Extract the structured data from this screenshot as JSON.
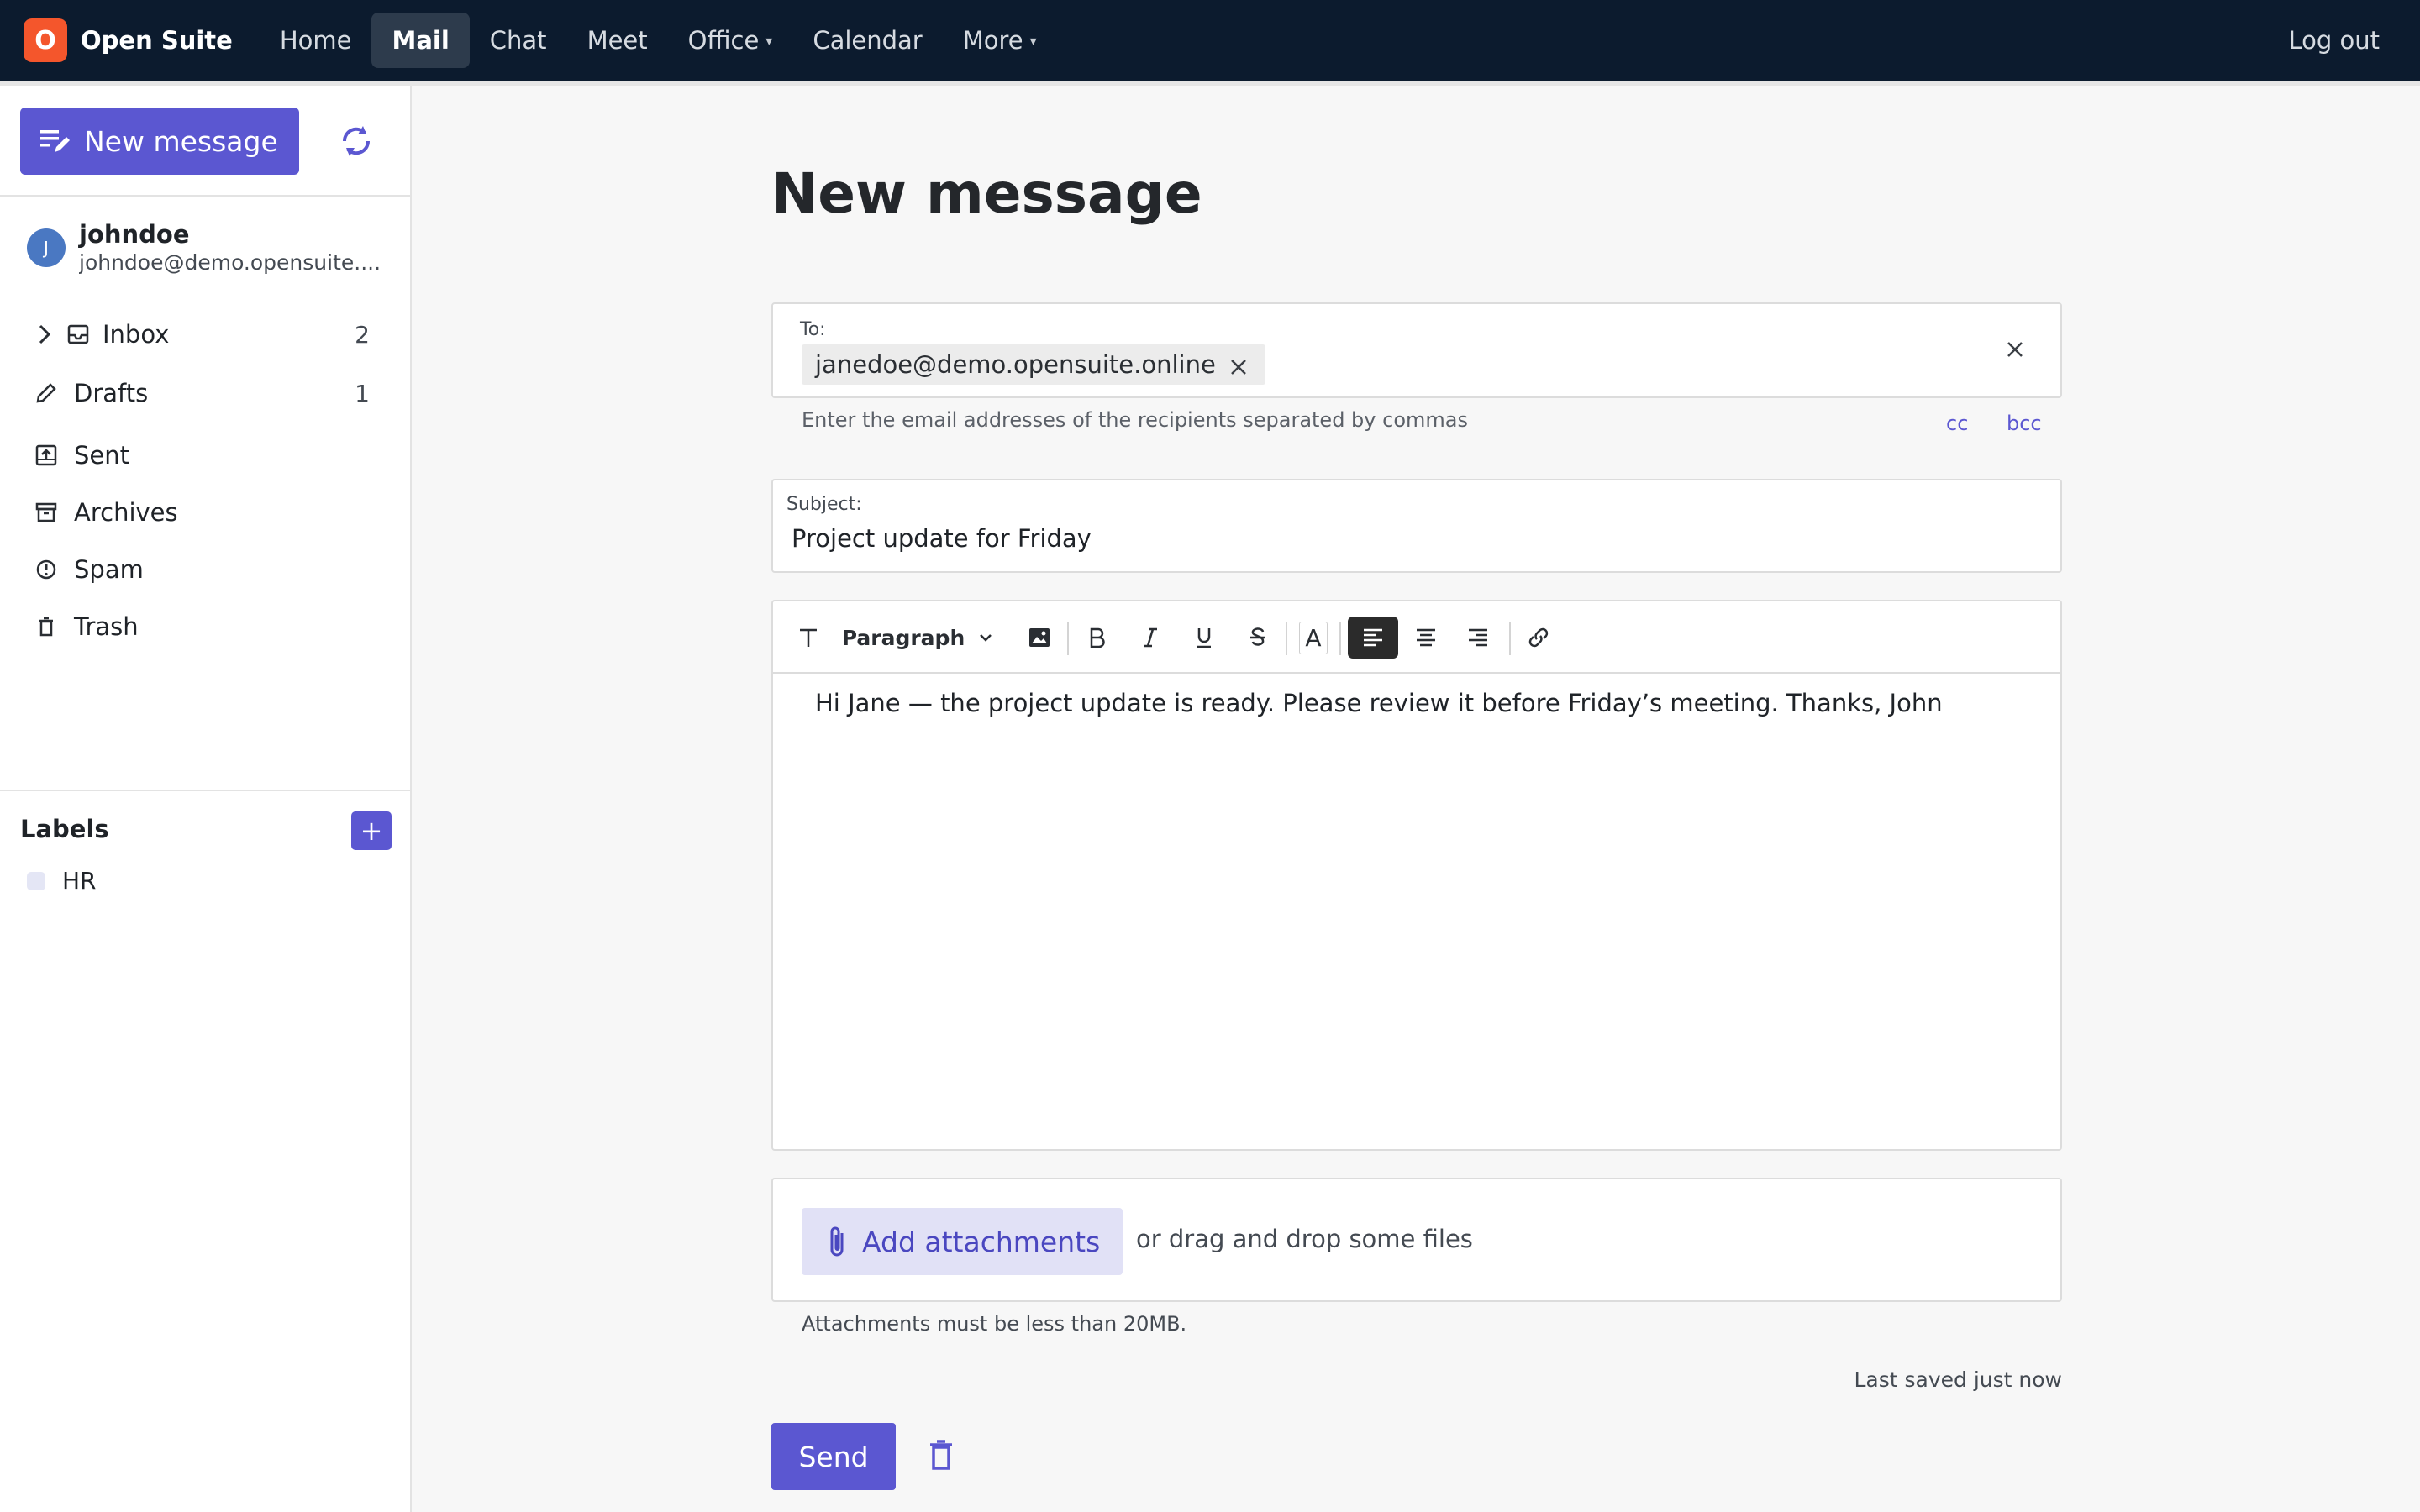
{
  "app": {
    "logo_letter": "O",
    "name": "Open Suite",
    "accent": "#5b57d1",
    "logo_color": "#f4562c"
  },
  "nav": {
    "items": [
      {
        "label": "Home"
      },
      {
        "label": "Mail",
        "active": true
      },
      {
        "label": "Chat"
      },
      {
        "label": "Meet"
      },
      {
        "label": "Office",
        "dropdown": true
      },
      {
        "label": "Calendar"
      },
      {
        "label": "More",
        "dropdown": true
      }
    ],
    "caret": "▾",
    "logout": "Log out"
  },
  "sidebar": {
    "new_message": "New message",
    "account": {
      "initial": "J",
      "name": "johndoe",
      "email": "johndoe@demo.opensuite...."
    },
    "folders": [
      {
        "label": "Inbox",
        "count": "2",
        "icon": "inbox-icon"
      },
      {
        "label": "Drafts",
        "count": "1",
        "icon": "pencil-icon"
      },
      {
        "label": "Sent",
        "count": "",
        "icon": "sent-icon"
      },
      {
        "label": "Archives",
        "count": "",
        "icon": "archive-icon"
      },
      {
        "label": "Spam",
        "count": "",
        "icon": "spam-icon"
      },
      {
        "label": "Trash",
        "count": "",
        "icon": "trash-icon"
      }
    ],
    "labels_title": "Labels",
    "add_label": "+",
    "labels": [
      {
        "name": "HR"
      }
    ]
  },
  "compose": {
    "title": "New message",
    "to_label": "To:",
    "to_chip": "janedoe@demo.opensuite.online",
    "to_hint": "Enter the email addresses of the recipients separated by commas",
    "cc": "cc",
    "bcc": "bcc",
    "subject_label": "Subject:",
    "subject_value": "Project update for Friday",
    "toolbar": {
      "paragraph": "Paragraph",
      "text_color_glyph": "A"
    },
    "body": "Hi Jane — the project update is ready. Please review it before Friday’s meeting. Thanks, John",
    "attach_button": "Add attachments",
    "drop_text": "or drag and drop some files",
    "attach_note": "Attachments must be less than 20MB.",
    "last_saved": "Last saved just now",
    "send": "Send"
  }
}
